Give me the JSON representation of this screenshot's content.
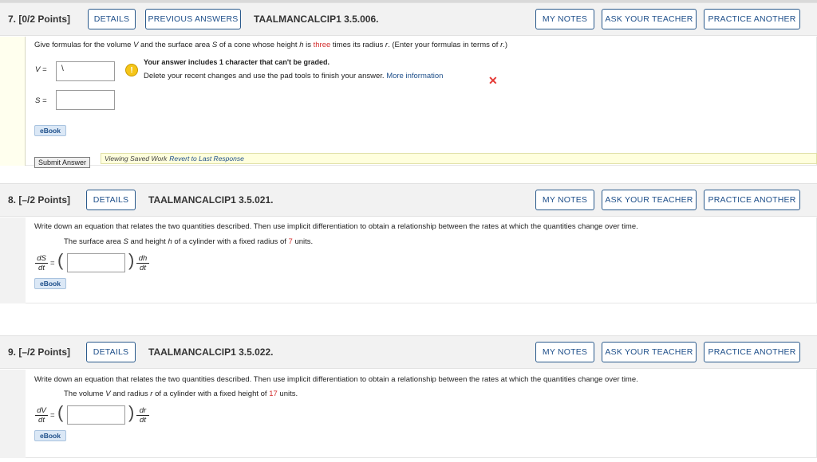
{
  "q7": {
    "number": "7.",
    "points": "[0/2 Points]",
    "details": "DETAILS",
    "previous_answers": "PREVIOUS ANSWERS",
    "id": "TAALMANCALCIP1 3.5.006.",
    "my_notes": "MY NOTES",
    "ask_teacher": "ASK YOUR TEACHER",
    "practice_another": "PRACTICE ANOTHER",
    "prompt_part1": "Give formulas for the volume ",
    "prompt_V": "V",
    "prompt_part2": " and the surface area ",
    "prompt_S": "S",
    "prompt_part3": " of a cone whose height ",
    "prompt_h": "h",
    "prompt_part4": " is ",
    "prompt_three": "three",
    "prompt_part5": " times its radius ",
    "prompt_r": "r",
    "prompt_part6": ". (Enter your formulas in terms of ",
    "prompt_r2": "r",
    "prompt_part7": ".)",
    "v_label": "V  =",
    "v_value": "\\",
    "s_label": "S  =",
    "s_value": "",
    "warning_title": "Your answer includes 1 character that can't be graded.",
    "warning_body": "Delete your recent changes and use the pad tools to finish your answer.",
    "more_info": "More information",
    "ebook": "eBook",
    "submit": "Submit Answer",
    "viewing_saved": "Viewing Saved Work",
    "revert": "Revert to Last Response"
  },
  "q8": {
    "number": "8.",
    "points": "[–/2 Points]",
    "details": "DETAILS",
    "id": "TAALMANCALCIP1 3.5.021.",
    "my_notes": "MY NOTES",
    "ask_teacher": "ASK YOUR TEACHER",
    "practice_another": "PRACTICE ANOTHER",
    "prompt": "Write down an equation that relates the two quantities described. Then use implicit differentiation to obtain a relationship between the rates at which the quantities change over time.",
    "sub1": "The surface area ",
    "sub_S": "S",
    "sub2": " and height ",
    "sub_h": "h",
    "sub3": " of a cylinder with a fixed radius of ",
    "sub_num": "7",
    "sub4": " units.",
    "lhs_num": "dS",
    "lhs_den": "dt",
    "rhs_num": "dh",
    "rhs_den": "dt",
    "equals": "=",
    "answer": "",
    "ebook": "eBook"
  },
  "q9": {
    "number": "9.",
    "points": "[–/2 Points]",
    "details": "DETAILS",
    "id": "TAALMANCALCIP1 3.5.022.",
    "my_notes": "MY NOTES",
    "ask_teacher": "ASK YOUR TEACHER",
    "practice_another": "PRACTICE ANOTHER",
    "prompt": "Write down an equation that relates the two quantities described. Then use implicit differentiation to obtain a relationship between the rates at which the quantities change over time.",
    "sub1": "The volume ",
    "sub_V": "V",
    "sub2": " and radius ",
    "sub_r": "r",
    "sub3": " of a cylinder with a fixed height of ",
    "sub_num": "17",
    "sub4": " units.",
    "lhs_num": "dV",
    "lhs_den": "dt",
    "rhs_num": "dr",
    "rhs_den": "dt",
    "equals": "=",
    "answer": "",
    "ebook": "eBook"
  },
  "colors": {
    "accent": "#1e4f8a",
    "highlight": "#d32f2f",
    "warning": "#f5c518",
    "saved_bg": "#ffffdd"
  }
}
